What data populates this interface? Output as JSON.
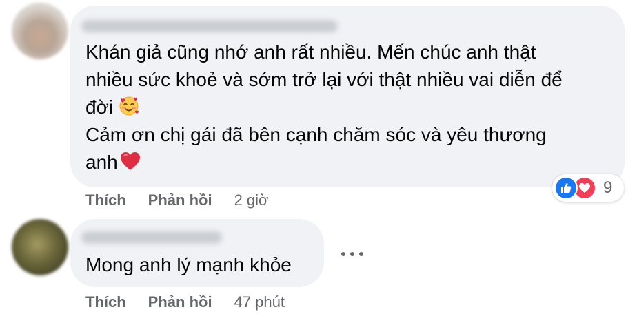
{
  "comments": [
    {
      "lines": [
        "Khán giả cũng nhớ anh rất nhiều. Mến chúc anh thật",
        "nhiều sức khoẻ và sớm trở lại với thật nhiều vai diễn để",
        "đời",
        "Cảm ơn chị gái đã bên cạnh chăm sóc và yêu thương",
        "anh"
      ],
      "emojis": [
        "smiling-face-with-hearts-emoji",
        "red-heart-emoji"
      ],
      "reactions": {
        "icons": [
          "like-icon",
          "love-icon"
        ],
        "count": "9"
      },
      "actions": {
        "like": "Thích",
        "reply": "Phản hồi",
        "time": "2 giờ"
      }
    },
    {
      "lines": [
        "Mong anh lý mạnh khỏe"
      ],
      "actions": {
        "like": "Thích",
        "reply": "Phản hồi",
        "time": "47 phút"
      }
    }
  ],
  "colors": {
    "bubble": "#f0f2f5",
    "text": "#050505",
    "secondary": "#65676b",
    "like_blue": "#1877f2",
    "love_red": "#f33e58"
  }
}
